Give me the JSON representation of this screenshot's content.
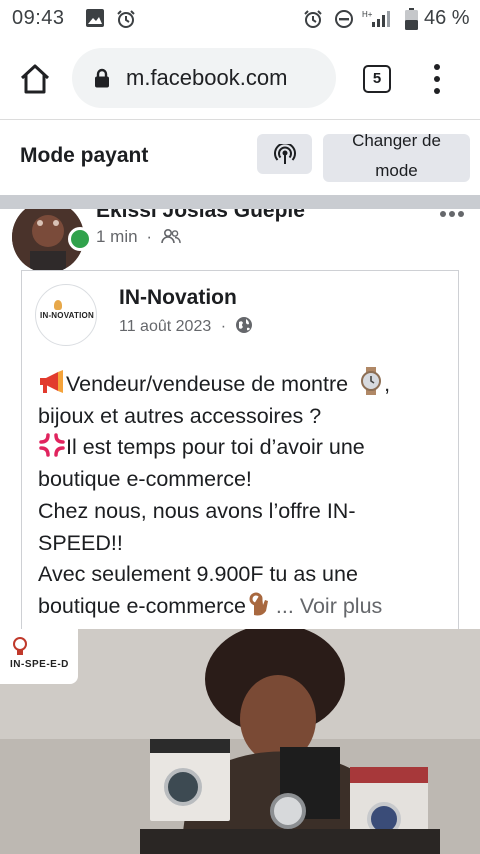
{
  "status_bar": {
    "time": "09:43",
    "battery": "46 %",
    "icons": [
      "image-icon",
      "alarm-icon",
      "alarm-icon",
      "do-not-disturb-icon",
      "network-icon",
      "signal-icon",
      "battery-icon"
    ]
  },
  "browser": {
    "url": "m.facebook.com",
    "tab_count": "5"
  },
  "mode_bar": {
    "title": "Mode payant",
    "switch_label_line1": "Changer de",
    "switch_label_line2": "mode"
  },
  "post": {
    "author": "Ekissi Josias Guépié",
    "time": "1 min",
    "separator": "·",
    "shared": {
      "page_name": "IN-Novation",
      "page_logo_text": "IN-NOVATION",
      "date": "11 août 2023",
      "separator": "·",
      "lines": [
        "Vendeur/vendeuse de montre",
        "bijoux et autres accessoires ?",
        "Il est temps pour toi d’avoir une",
        "boutique e-commerce!",
        "Chez nous, nous avons l’offre IN-",
        "SPEED!!",
        "Avec seulement 9.900F tu as une",
        "boutique e-commerce"
      ],
      "punct_after_watch": ",",
      "see_more": "... Voir plus"
    },
    "media_logo_text": "IN-SPE-E-D"
  },
  "colors": {
    "online": "#31a24c",
    "separator_gray": "#c9ccd1",
    "button_gray": "#e4e6eb",
    "meta_text": "#65676b"
  }
}
